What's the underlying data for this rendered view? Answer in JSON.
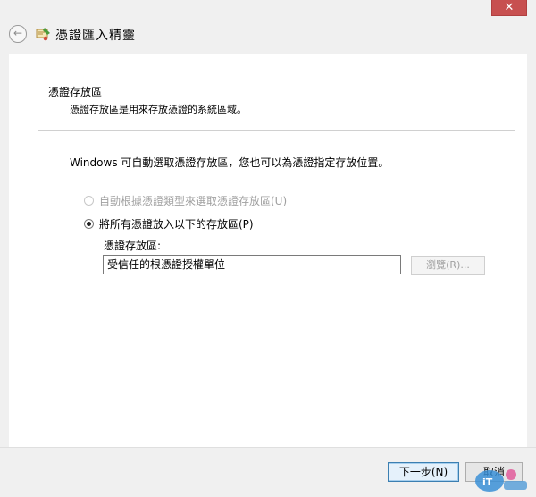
{
  "window": {
    "close_glyph": "✕"
  },
  "header": {
    "back_icon": "back-arrow-icon",
    "wizard_icon": "certificate-wizard-icon",
    "title": "憑證匯入精靈"
  },
  "page": {
    "section_title": "憑證存放區",
    "section_desc": "憑證存放區是用來存放憑證的系統區域。",
    "intro": "Windows 可自動選取憑證存放區，您也可以為憑證指定存放位置。",
    "option_auto": {
      "label": "自動根據憑證類型來選取憑證存放區(U)",
      "checked": false,
      "enabled": false
    },
    "option_manual": {
      "label": "將所有憑證放入以下的存放區(P)",
      "checked": true,
      "enabled": true
    },
    "store_label": "憑證存放區:",
    "store_value": "受信任的根憑證授權單位",
    "browse_label": "瀏覽(R)..."
  },
  "footer": {
    "next_label": "下一步(N)",
    "cancel_label": "取消"
  },
  "colors": {
    "close_button": "#c75050",
    "content_bg": "#ffffff",
    "chrome_bg": "#f0f0f0",
    "disabled_text": "#a0a0a0"
  }
}
